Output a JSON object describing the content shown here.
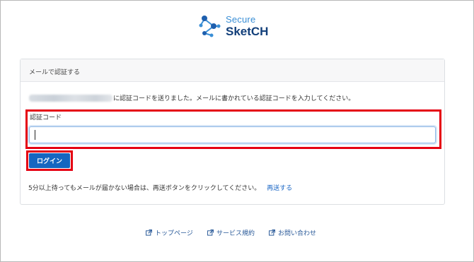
{
  "logo": {
    "line1": "Secure",
    "line2": "SketCH",
    "icon": "network-nodes-icon"
  },
  "card": {
    "header": "メールで認証する",
    "info_text": "に認証コードを送りました。メールに書かれている認証コードを入力してください。",
    "field_label": "認証コード",
    "code_value": "",
    "login_label": "ログイン",
    "resend_text": "5分以上待ってもメールが届かない場合は、再送ボタンをクリックしてください。",
    "resend_link": "再送する"
  },
  "footer": {
    "links": [
      {
        "label": "トップページ",
        "icon": "external-link-icon"
      },
      {
        "label": "サービス規約",
        "icon": "external-link-icon"
      },
      {
        "label": "お問い合わせ",
        "icon": "external-link-icon"
      }
    ]
  },
  "colors": {
    "primary": "#1566c0",
    "highlight": "#e50012",
    "logo_light": "#3a8fd6",
    "logo_dark": "#123f7a"
  }
}
